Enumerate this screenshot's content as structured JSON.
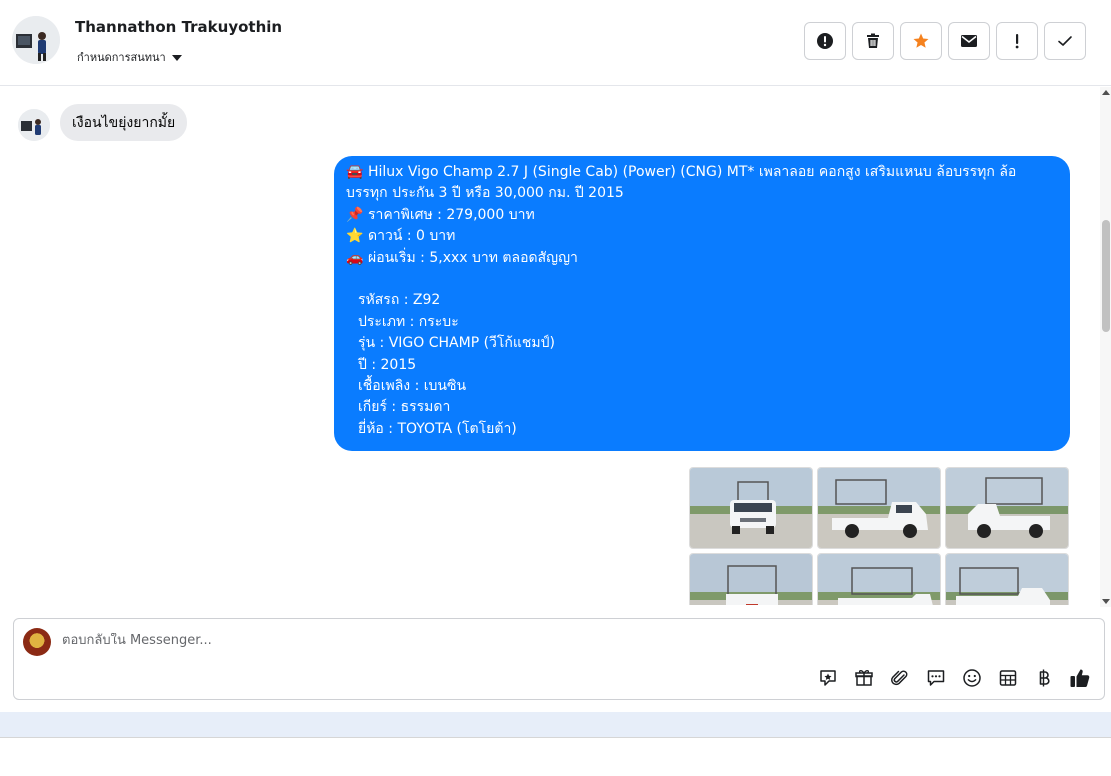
{
  "header": {
    "contact_name": "Thannathon Trakuyothin",
    "subtitle": "กำหนดการสนทนา",
    "actions": [
      {
        "icon": "exclamation-circle-icon"
      },
      {
        "icon": "trash-icon"
      },
      {
        "icon": "star-icon",
        "color": "#f5821f"
      },
      {
        "icon": "envelope-icon"
      },
      {
        "icon": "exclamation-icon"
      },
      {
        "icon": "check-icon"
      }
    ]
  },
  "conversation": {
    "incoming_message": "เงือนไขยุ่งยากมั้ย",
    "outgoing": {
      "title_emoji": "🚘",
      "title": "Hilux Vigo Champ 2.7 J (Single Cab) (Power) (CNG) MT* เพลาลอย คอกสูง เสริมแหนบ ล้อบรรทุก ล้อบรรทุก ประกัน 3 ปี หรือ 30,000 กม. ปี 2015",
      "price_emoji": "📌",
      "price": "ราคาพิเศษ : 279,000 บาท",
      "down_emoji": "⭐",
      "down": "ดาวน์ : 0 บาท",
      "installment_emoji": "🚗",
      "installment": "ผ่อนเริ่ม : 5,xxx บาท ตลอดสัญญา",
      "code": "รหัสรถ : Z92",
      "type": "ประเภท : กระบะ",
      "model": "รุ่น : VIGO CHAMP (วีโก้แชมป์)",
      "year": "ปี : 2015",
      "fuel": "เชื้อเพลิง : เบนซิน",
      "gear": "เกียร์ : ธรรมดา",
      "brand": "ยี่ห้อ : TOYOTA (โตโยต้า)"
    },
    "colors": {
      "outgoing_bubble": "#0a7cff",
      "incoming_bubble": "#e9eaed"
    }
  },
  "composer": {
    "placeholder": "ตอบกลับใน Messenger...",
    "tools": [
      "sticker-icon",
      "gift-icon",
      "paperclip-icon",
      "chat-bubbles-icon",
      "emoji-icon",
      "table-icon",
      "baht-icon",
      "thumbs-up-icon"
    ]
  }
}
